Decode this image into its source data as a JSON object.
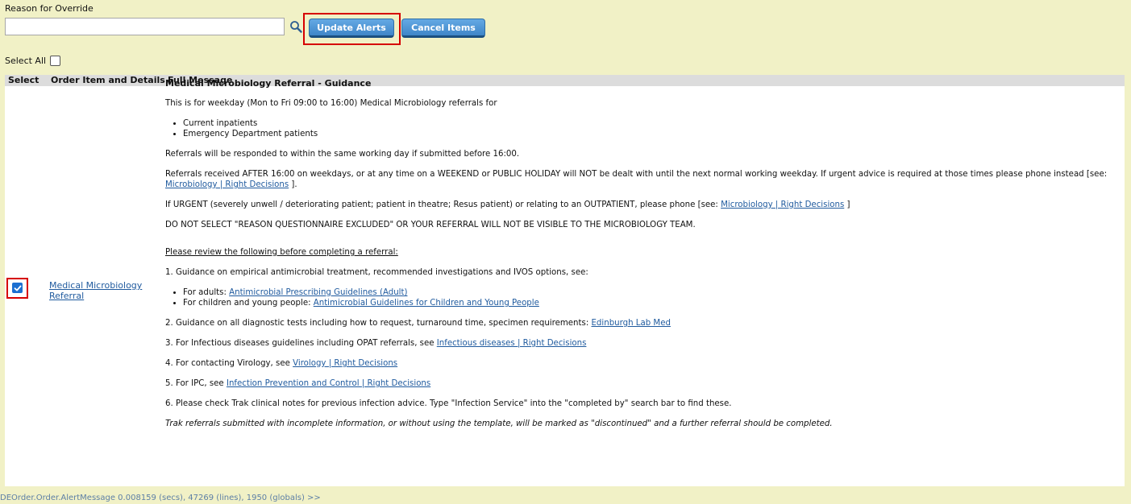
{
  "form": {
    "reason_label": "Reason for Override",
    "reason_value": "",
    "update_button": "Update Alerts",
    "cancel_button": "Cancel Items",
    "select_all_label": "Select All",
    "select_all_checked": false
  },
  "table": {
    "columns": [
      "Select",
      "Order Item and Details",
      "Full Message"
    ],
    "row": {
      "selected": true,
      "order_item": "Medical Microbiology Referral"
    }
  },
  "message": {
    "title": "Medical Microbiology Referral - Guidance",
    "intro": "This is for weekday (Mon to Fri 09:00 to 16:00) Medical Microbiology referrals for",
    "intro_list": [
      "Current inpatients",
      "Emergency Department patients"
    ],
    "p_responded": "Referrals will be responded to within the same working day if submitted before 16:00.",
    "p_after_pre": "Referrals received AFTER 16:00 on weekdays, or at any time on a WEEKEND or PUBLIC HOLIDAY will NOT be dealt with until the next normal working weekday. If urgent advice is required at those times please phone instead [see:",
    "p_after_link": "Microbiology | Right Decisions",
    "p_after_post": " ].",
    "p_urgent_pre": "If URGENT (severely unwell / deteriorating patient; patient in theatre; Resus patient) or relating to an OUTPATIENT, please phone [see: ",
    "p_urgent_link": "Microbiology | Right Decisions",
    "p_urgent_post": " ]",
    "p_donot": "DO NOT SELECT \"REASON QUESTIONNAIRE EXCLUDED\" OR YOUR REFERRAL WILL NOT BE VISIBLE TO THE MICROBIOLOGY TEAM.",
    "review_heading": "Please review the following before completing a referral:",
    "item1": "1. Guidance on empirical antimicrobial treatment, recommended investigations and IVOS options, see:",
    "item1_adults_pre": "For adults: ",
    "item1_adults_link": "Antimicrobial Prescribing Guidelines (Adult)",
    "item1_children_pre": "For children and young people: ",
    "item1_children_link": "Antimicrobial Guidelines for Children and Young People",
    "item2_pre": "2. Guidance on all diagnostic tests including how to request, turnaround time, specimen requirements: ",
    "item2_link": "Edinburgh Lab Med",
    "item3_pre": "3. For Infectious diseases guidelines including OPAT referrals, see ",
    "item3_link": "Infectious diseases | Right Decisions",
    "item4_pre": "4. For contacting Virology, see ",
    "item4_link": "Virology | Right Decisions",
    "item5_pre": "5. For IPC, see ",
    "item5_link": "Infection Prevention and Control | Right Decisions",
    "item6": "6. Please check Trak clinical notes for previous infection advice. Type \"Infection Service\" into the \"completed by\" search bar to find these.",
    "footer_note": "Trak referrals submitted with incomplete information, or without using the template, will be marked as \"discontinued\" and a further referral should be completed."
  },
  "footer": {
    "text": "DEOrder.Order.AlertMessage  0.008159 (secs),  47269 (lines),  1950 (globals) >>"
  }
}
